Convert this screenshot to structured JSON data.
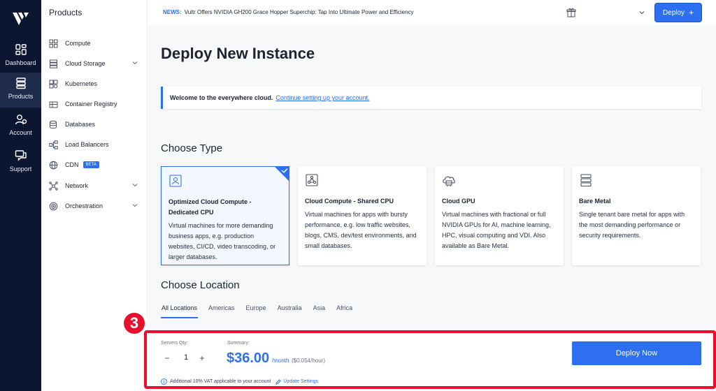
{
  "rail": {
    "items": [
      {
        "label": "Dashboard",
        "icon": "dashboard-icon"
      },
      {
        "label": "Products",
        "icon": "products-icon"
      },
      {
        "label": "Account",
        "icon": "account-icon"
      },
      {
        "label": "Support",
        "icon": "support-icon"
      }
    ],
    "active": "Products",
    "colors": {
      "background": "#0d1630",
      "active": "#1f2b4a"
    }
  },
  "products_panel": {
    "title": "Products",
    "items": [
      {
        "label": "Compute",
        "icon": "compute-icon",
        "has_chevron": false
      },
      {
        "label": "Cloud Storage",
        "icon": "cloud-storage-icon",
        "has_chevron": true
      },
      {
        "label": "Kubernetes",
        "icon": "kubernetes-icon",
        "has_chevron": false
      },
      {
        "label": "Container Registry",
        "icon": "container-registry-icon",
        "has_chevron": false
      },
      {
        "label": "Databases",
        "icon": "databases-icon",
        "has_chevron": false
      },
      {
        "label": "Load Balancers",
        "icon": "load-balancers-icon",
        "has_chevron": false
      },
      {
        "label": "CDN",
        "icon": "cdn-icon",
        "has_chevron": false,
        "badge": "BETA"
      },
      {
        "label": "Network",
        "icon": "network-icon",
        "has_chevron": true
      },
      {
        "label": "Orchestration",
        "icon": "orchestration-icon",
        "has_chevron": true
      }
    ]
  },
  "topbar": {
    "news_label": "NEWS:",
    "news_text": "Vultr Offers NVIDIA GH200 Grace Hopper Superchip: Tap Into Ultimate Power and Efficiency",
    "deploy_label": "Deploy",
    "deploy_plus": "+"
  },
  "main": {
    "page_title": "Deploy New Instance",
    "welcome_bold": "Welcome to the everywhere cloud.",
    "welcome_link": "Continue setting up your account.",
    "choose_type_title": "Choose Type",
    "types": [
      {
        "title": "Optimized Cloud Compute - Dedicated CPU",
        "desc": "Virtual machines for more demanding business apps, e.g. production websites, CI/CD, video transcoding, or larger databases.",
        "icon": "optimized-compute-icon",
        "selected": true
      },
      {
        "title": "Cloud Compute - Shared CPU",
        "desc": "Virtual machines for apps with bursty performance, e.g. low traffic websites, blogs, CMS, dev/test environments, and small databases.",
        "icon": "shared-cpu-icon",
        "selected": false
      },
      {
        "title": "Cloud GPU",
        "desc": "Virtual machines with fractional or full NVIDIA GPUs for AI, machine learning, HPC, visual computing and VDI. Also available as Bare Metal.",
        "icon": "cloud-gpu-icon",
        "selected": false
      },
      {
        "title": "Bare Metal",
        "desc": "Single tenant bare metal for apps with the most demanding performance or security requirements.",
        "icon": "bare-metal-icon",
        "selected": false
      }
    ],
    "choose_location_title": "Choose Location",
    "location_tabs": [
      "All Locations",
      "Americas",
      "Europe",
      "Australia",
      "Asia",
      "Africa"
    ],
    "active_location_tab": "All Locations"
  },
  "deploy_bar": {
    "qty_label": "Servers Qty:",
    "qty_minus": "−",
    "qty_value": "1",
    "qty_plus": "+",
    "summary_label": "Summary:",
    "price": "$36.00",
    "price_period": "/month",
    "price_hourly": "($0.054/hour)",
    "deploy_now_label": "Deploy Now",
    "vat_text": "Additional 10% VAT applicable to your account",
    "update_settings": "Update Settings"
  },
  "annotation": {
    "step_number": "3",
    "color": "#e8102c"
  },
  "colors": {
    "accent": "#2e6ff2",
    "main_background": "#f7f8fa"
  }
}
